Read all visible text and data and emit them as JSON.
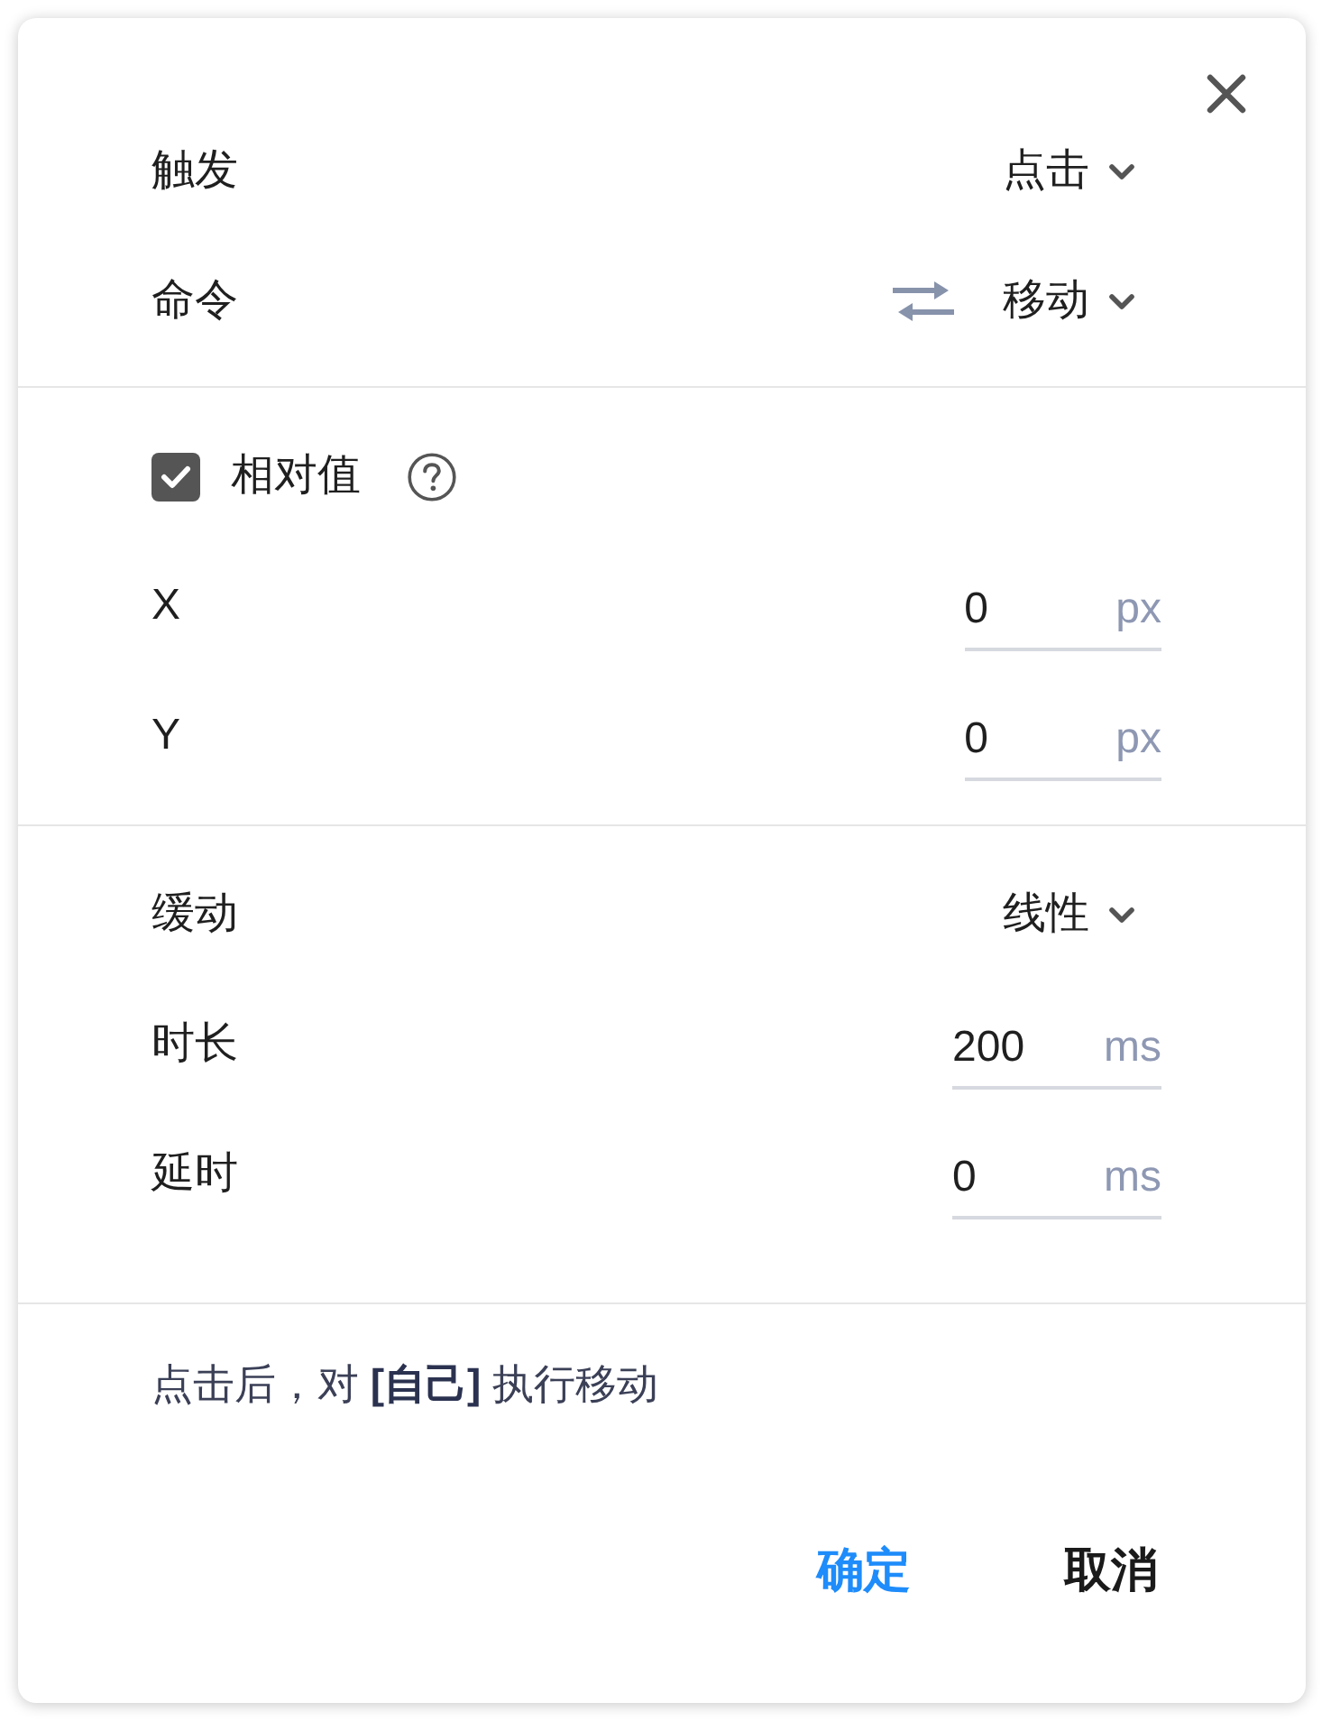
{
  "sections": [
    {
      "rows": [
        {
          "kind": "select",
          "label": "触发",
          "value": "点击"
        },
        {
          "kind": "select",
          "label": "命令",
          "value": "移动",
          "swap": true
        }
      ]
    },
    {
      "rows": [
        {
          "kind": "checkbox",
          "label": "相对值",
          "checked": true,
          "help": true
        },
        {
          "kind": "number",
          "label": "X",
          "value": "0",
          "unit": "px"
        },
        {
          "kind": "number",
          "label": "Y",
          "value": "0",
          "unit": "px"
        }
      ]
    },
    {
      "rows": [
        {
          "kind": "select",
          "label": "缓动",
          "value": "线性"
        },
        {
          "kind": "number",
          "label": "时长",
          "value": "200",
          "unit": "ms"
        },
        {
          "kind": "number",
          "label": "延时",
          "value": "0",
          "unit": "ms"
        }
      ]
    }
  ],
  "summary": "点击后，对 **[自己]** 执行移动",
  "buttons": [
    {
      "kind": "primary",
      "label": "确定"
    },
    {
      "kind": "secondary",
      "label": "取消"
    }
  ]
}
